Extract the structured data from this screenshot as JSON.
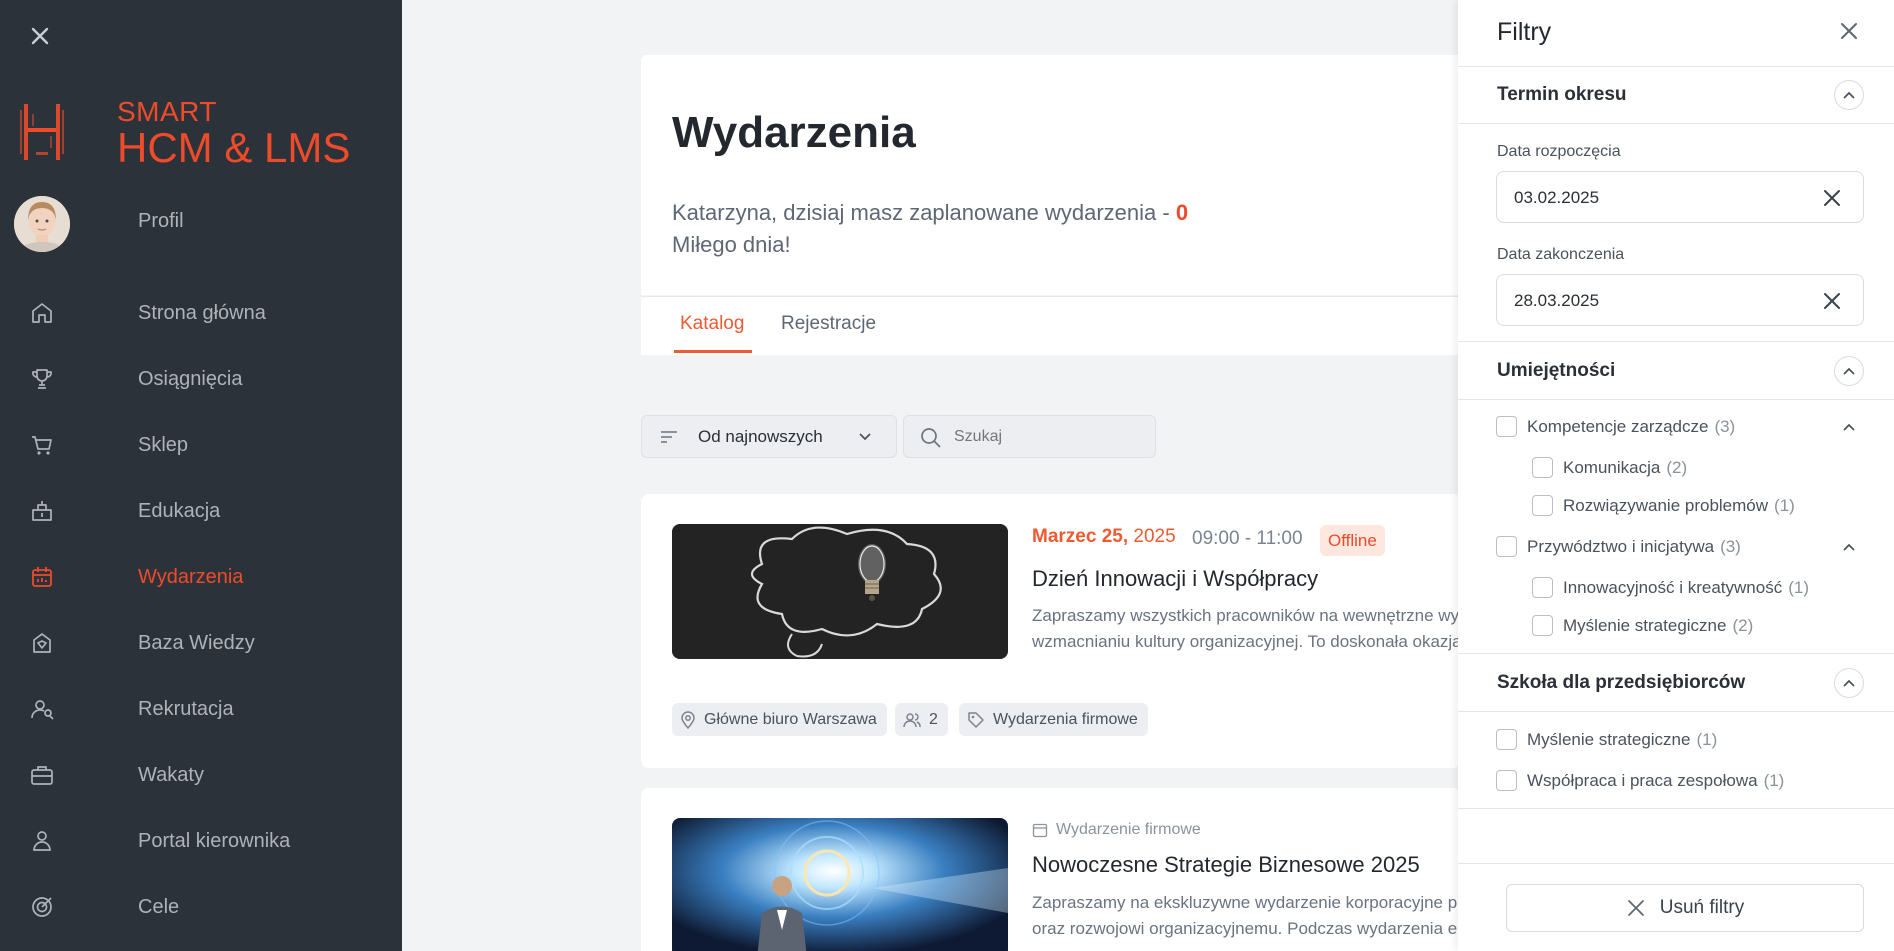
{
  "brand": {
    "line1": "SMART",
    "line2": "HCM & LMS"
  },
  "sidebar": {
    "items": [
      {
        "label": "Profil",
        "icon": "avatar"
      },
      {
        "label": "Strona główna",
        "icon": "home-icon"
      },
      {
        "label": "Osiągnięcia",
        "icon": "trophy-icon"
      },
      {
        "label": "Sklep",
        "icon": "cart-icon"
      },
      {
        "label": "Edukacja",
        "icon": "education-icon"
      },
      {
        "label": "Wydarzenia",
        "icon": "calendar-icon",
        "active": true
      },
      {
        "label": "Baza Wiedzy",
        "icon": "knowledge-icon"
      },
      {
        "label": "Rekrutacja",
        "icon": "recruitment-icon"
      },
      {
        "label": "Wakaty",
        "icon": "briefcase-icon"
      },
      {
        "label": "Portal kierownika",
        "icon": "manager-icon"
      },
      {
        "label": "Cele",
        "icon": "target-icon"
      }
    ]
  },
  "main": {
    "title": "Wydarzenia",
    "greeting": "Katarzyna, dzisiaj masz zaplanowane wydarzenia - ",
    "greeting_count": "0",
    "greeting_line2": "Miłego dnia!",
    "tabs": [
      {
        "label": "Katalog",
        "active": true
      },
      {
        "label": "Rejestracje"
      }
    ],
    "sort_label": "Od najnowszych",
    "search_placeholder": "Szukaj"
  },
  "events": [
    {
      "date_month": "Marzec 25,",
      "date_year": "2025",
      "time": "09:00 - 11:00",
      "badge": "Offline",
      "title": "Dzień Innowacji i Współpracy",
      "desc_line1": "Zapraszamy wszystkich pracowników na wewnętrzne wyd",
      "desc_line2": "wzmacnianiu kultury organizacyjnej. To doskonała okazja",
      "location": "Główne biuro Warszawa",
      "participants": "2",
      "category": "Wydarzenia firmowe"
    },
    {
      "type": "Wydarzenie firmowe",
      "title": "Nowoczesne Strategie Biznesowe 2025",
      "desc_line1": "Zapraszamy na ekskluzywne wydarzenie korporacyjne po",
      "desc_line2": "oraz rozwojowi organizacyjnemu. Podczas wydarzenia ek"
    }
  ],
  "filters": {
    "title": "Filtry",
    "period": {
      "title": "Termin okresu",
      "start_label": "Data rozpoczęcia",
      "start_value": "03.02.2025",
      "end_label": "Data zakonczenia",
      "end_value": "28.03.2025"
    },
    "skills": {
      "title": "Umiejętności",
      "groups": [
        {
          "label": "Kompetencje zarządcze",
          "count": "(3)",
          "children": [
            {
              "label": "Komunikacja",
              "count": "(2)"
            },
            {
              "label": "Rozwiązywanie problemów",
              "count": "(1)"
            }
          ]
        },
        {
          "label": "Przywództwo i inicjatywa",
          "count": "(3)",
          "children": [
            {
              "label": "Innowacyjność i kreatywność",
              "count": "(1)"
            },
            {
              "label": "Myślenie strategiczne",
              "count": "(2)"
            }
          ]
        }
      ]
    },
    "school": {
      "title": "Szkoła dla przedsiębiorców",
      "items": [
        {
          "label": "Myślenie strategiczne",
          "count": "(1)"
        },
        {
          "label": "Współpraca i praca zespołowa",
          "count": "(1)"
        }
      ]
    },
    "reset_label": "Usuń filtry"
  },
  "colors": {
    "accent": "#ee4b2b",
    "sidebar_bg": "#2c3239",
    "page_bg": "#f2f3f5"
  }
}
